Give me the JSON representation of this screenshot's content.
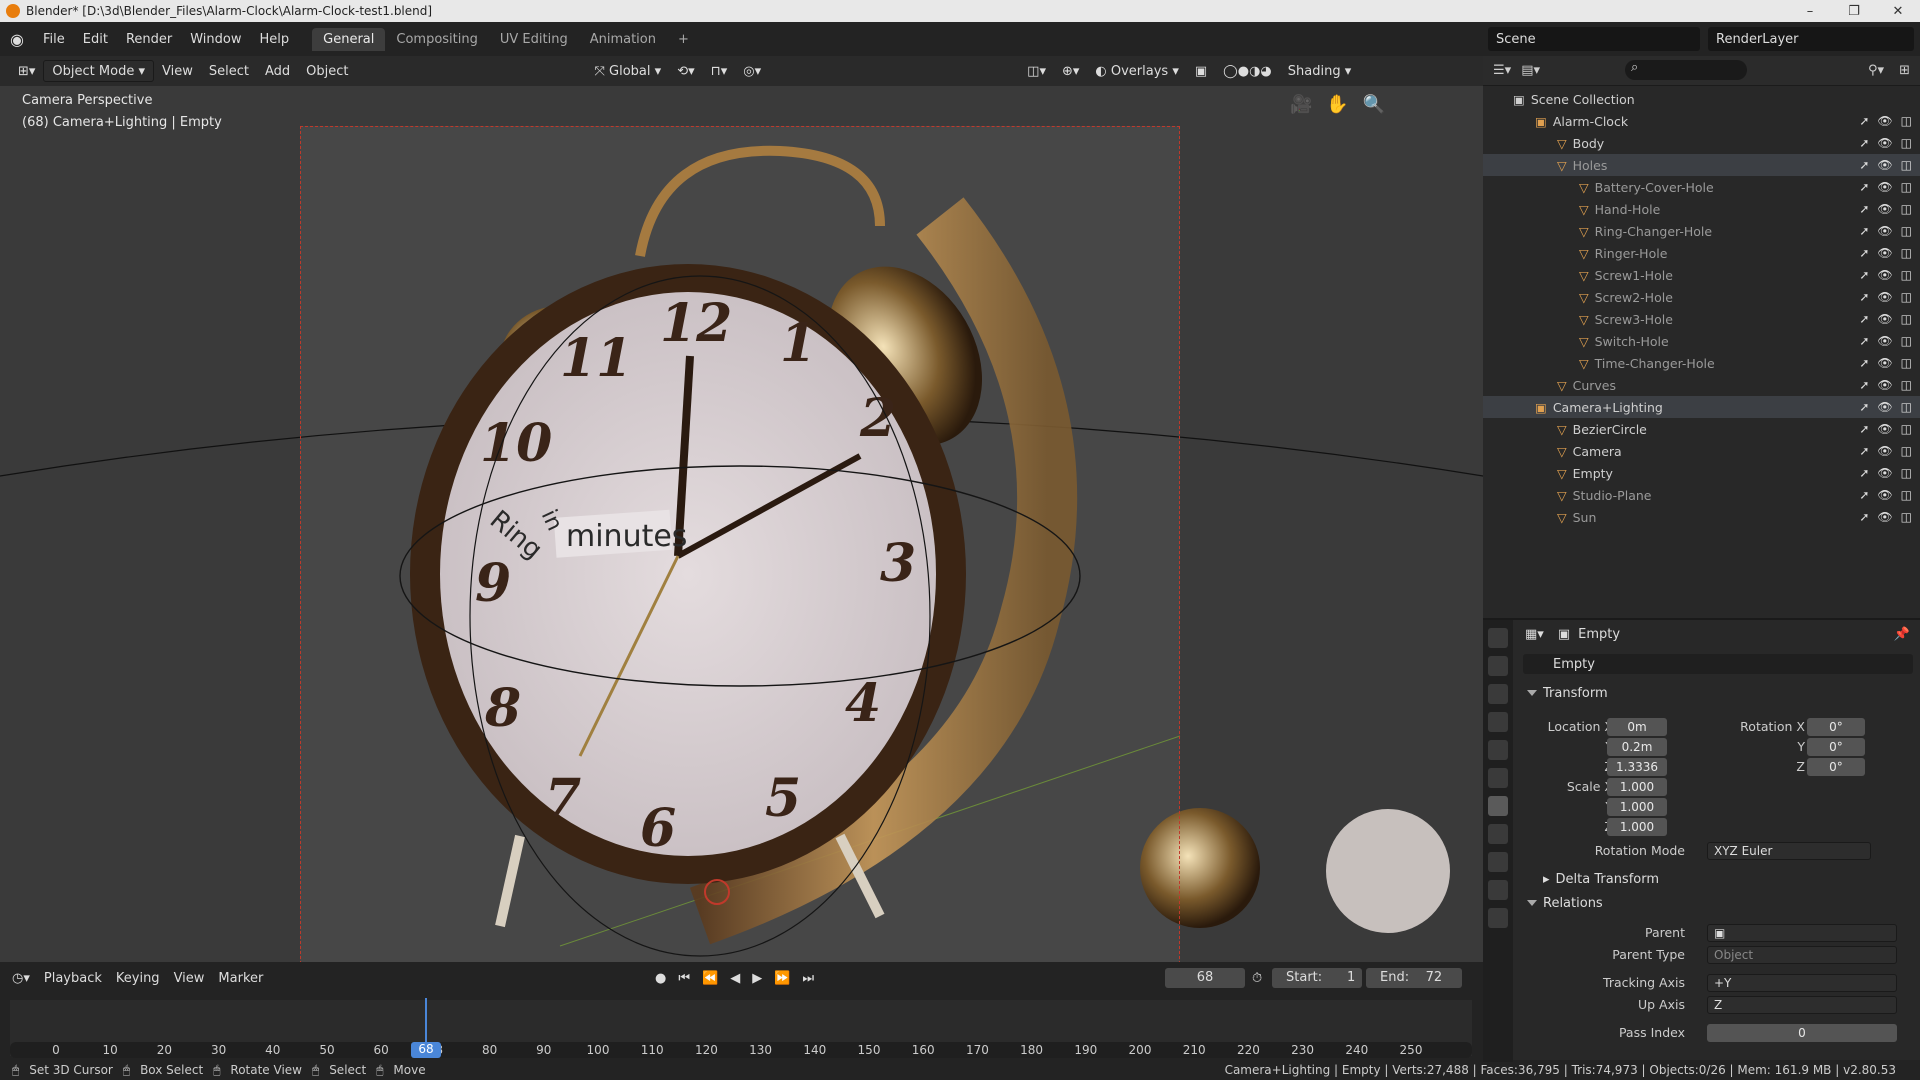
{
  "window": {
    "title": "Blender* [D:\\3d\\Blender_Files\\Alarm-Clock\\Alarm-Clock-test1.blend]"
  },
  "menu": {
    "items": [
      "File",
      "Edit",
      "Render",
      "Window",
      "Help"
    ]
  },
  "workspaces": {
    "tabs": [
      "General",
      "Compositing",
      "UV Editing",
      "Animation"
    ],
    "active": "General",
    "add": "+"
  },
  "scene": {
    "name": "Scene",
    "render_layer": "RenderLayer"
  },
  "viewport": {
    "mode": "Object Mode",
    "menus": [
      "View",
      "Select",
      "Add",
      "Object"
    ],
    "orientation": "Global",
    "overlays": "Overlays",
    "shading": "Shading",
    "info_line1": "Camera Perspective",
    "info_line2": "(68) Camera+Lighting | Empty",
    "clock_numbers": [
      "12",
      "1",
      "2",
      "3",
      "4",
      "5",
      "6",
      "7",
      "8",
      "9",
      "10",
      "11"
    ],
    "text_ring": "Ring",
    "text_in": "in",
    "text_minutes": "minutes"
  },
  "outliner": {
    "root": "Scene Collection",
    "items": [
      {
        "name": "Alarm-Clock",
        "depth": 1
      },
      {
        "name": "Body",
        "depth": 2
      },
      {
        "name": "Holes",
        "depth": 2
      },
      {
        "name": "Battery-Cover-Hole",
        "depth": 3
      },
      {
        "name": "Hand-Hole",
        "depth": 3
      },
      {
        "name": "Ring-Changer-Hole",
        "depth": 3
      },
      {
        "name": "Ringer-Hole",
        "depth": 3
      },
      {
        "name": "Screw1-Hole",
        "depth": 3
      },
      {
        "name": "Screw2-Hole",
        "depth": 3
      },
      {
        "name": "Screw3-Hole",
        "depth": 3
      },
      {
        "name": "Switch-Hole",
        "depth": 3
      },
      {
        "name": "Time-Changer-Hole",
        "depth": 3
      },
      {
        "name": "Curves",
        "depth": 2
      },
      {
        "name": "Camera+Lighting",
        "depth": 1
      },
      {
        "name": "BezierCircle",
        "depth": 2
      },
      {
        "name": "Camera",
        "depth": 2
      },
      {
        "name": "Empty",
        "depth": 2
      },
      {
        "name": "Studio-Plane",
        "depth": 2
      },
      {
        "name": "Sun",
        "depth": 2
      }
    ]
  },
  "properties": {
    "header": "Empty",
    "object_name": "Empty",
    "transform": "Transform",
    "location_label": "Location X",
    "loc": [
      "0m",
      "0.2m",
      "1.3336"
    ],
    "rotation_label": "Rotation X",
    "rot": [
      "0°",
      "0°",
      "0°"
    ],
    "scale_label": "Scale X",
    "scale": [
      "1.000",
      "1.000",
      "1.000"
    ],
    "y": "Y",
    "z": "Z",
    "rotation_mode_label": "Rotation Mode",
    "rotation_mode": "XYZ Euler",
    "delta": "Delta Transform",
    "relations": "Relations",
    "parent_label": "Parent",
    "parent_type_label": "Parent Type",
    "parent_type": "Object",
    "tracking_axis_label": "Tracking Axis",
    "tracking_axis": "+Y",
    "up_axis_label": "Up Axis",
    "up_axis": "Z",
    "pass_index_label": "Pass Index",
    "pass_index": "0"
  },
  "timeline": {
    "menus": [
      "Playback",
      "Keying",
      "View",
      "Marker"
    ],
    "current": "68",
    "start_label": "Start:",
    "start": "1",
    "end_label": "End:",
    "end": "72",
    "ticks": [
      "0",
      "10",
      "20",
      "30",
      "40",
      "50",
      "60",
      "68",
      "80",
      "90",
      "100",
      "110",
      "120",
      "130",
      "140",
      "150",
      "160",
      "170",
      "180",
      "190",
      "200",
      "210",
      "220",
      "230",
      "240",
      "250"
    ]
  },
  "status": {
    "left": [
      "Set 3D Cursor",
      "Box Select",
      "Rotate View",
      "Select",
      "Move"
    ],
    "right": "Camera+Lighting | Empty | Verts:27,488 | Faces:36,795 | Tris:74,973 | Objects:0/26 | Mem: 161.9 MB | v2.80.53"
  }
}
